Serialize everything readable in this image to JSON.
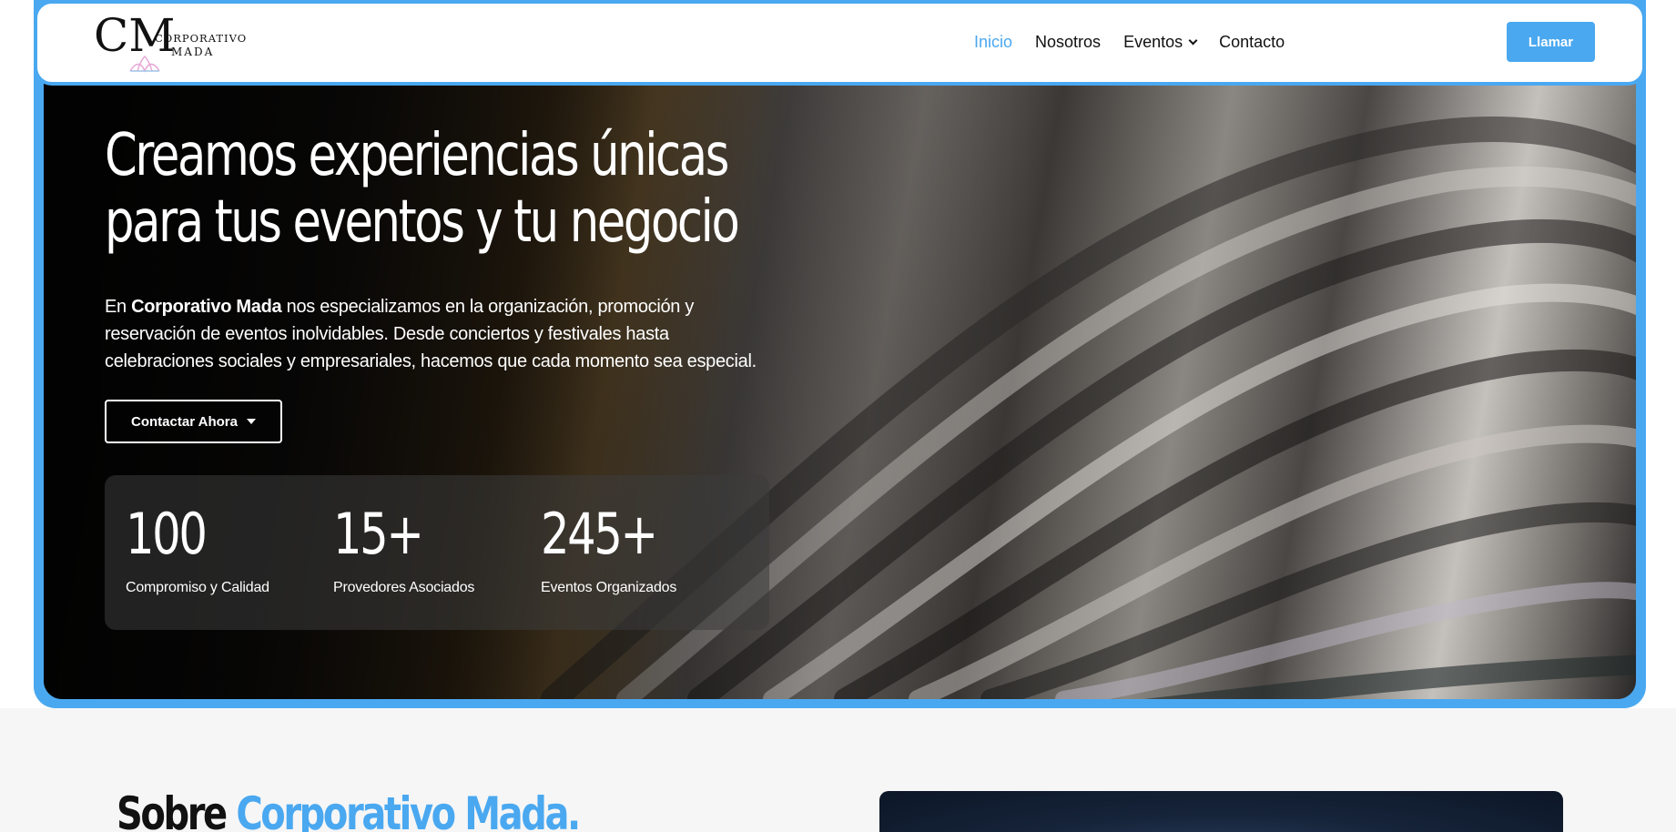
{
  "header": {
    "logo": {
      "line1": "CORPORATIVO",
      "line2": "MADA",
      "monogram": "CM",
      "flower_icon": "lotus-icon"
    },
    "nav": [
      {
        "label": "Inicio",
        "active": true
      },
      {
        "label": "Nosotros",
        "active": false
      },
      {
        "label": "Eventos",
        "active": false,
        "dropdown": true
      },
      {
        "label": "Contacto",
        "active": false
      }
    ],
    "call_button": "Llamar"
  },
  "hero": {
    "title_line1": "Creamos experiencias únicas",
    "title_line2": "para tus eventos y tu negocio",
    "desc_prefix": "En ",
    "desc_brand": "Corporativo Mada",
    "desc_rest": " nos especializamos en la organización, promoción y reservación de eventos inolvidables. Desde conciertos y festivales hasta celebraciones sociales y empresariales, hacemos que cada momento sea especial.",
    "cta_label": "Contactar Ahora",
    "stats": [
      {
        "value": "100",
        "label": "Compromiso y Calidad"
      },
      {
        "value": "15+",
        "label": "Provedores Asociados"
      },
      {
        "value": "245+",
        "label": "Eventos Organizados"
      }
    ]
  },
  "about": {
    "title_prefix": "Sobre ",
    "title_highlight": "Corporativo Mada."
  },
  "colors": {
    "accent": "#4aa8f0",
    "text": "#111111",
    "section_bg": "#f6f6f6"
  }
}
